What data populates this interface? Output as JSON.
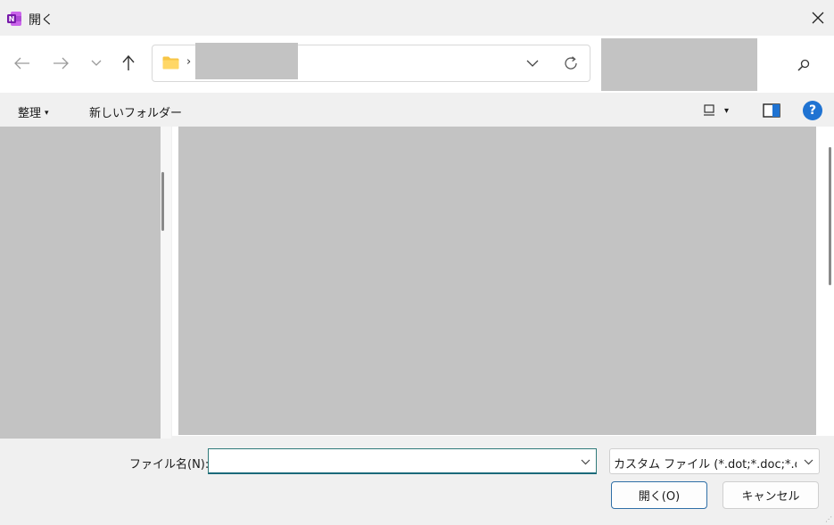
{
  "window": {
    "title": "開く",
    "app_icon": "onenote-icon",
    "app_icon_letter": "N"
  },
  "address_bar": {
    "separator": "›",
    "folder_icon": "folder-icon"
  },
  "toolbar": {
    "organize_label": "整理",
    "organize_caret": "▾",
    "new_folder_label": "新しいフォルダー",
    "view_caret": "▾",
    "help_label": "?"
  },
  "bottom": {
    "filename_label": "ファイル名(N):",
    "filename_value": "",
    "filetype_value": "カスタム ファイル (*.dot;*.doc;*.doc",
    "open_label": "開く(O)",
    "cancel_label": "キャンセル"
  },
  "colors": {
    "accent": "#1f73d2",
    "redacted": "#c3c3c3",
    "onenote": "#7719aa"
  }
}
